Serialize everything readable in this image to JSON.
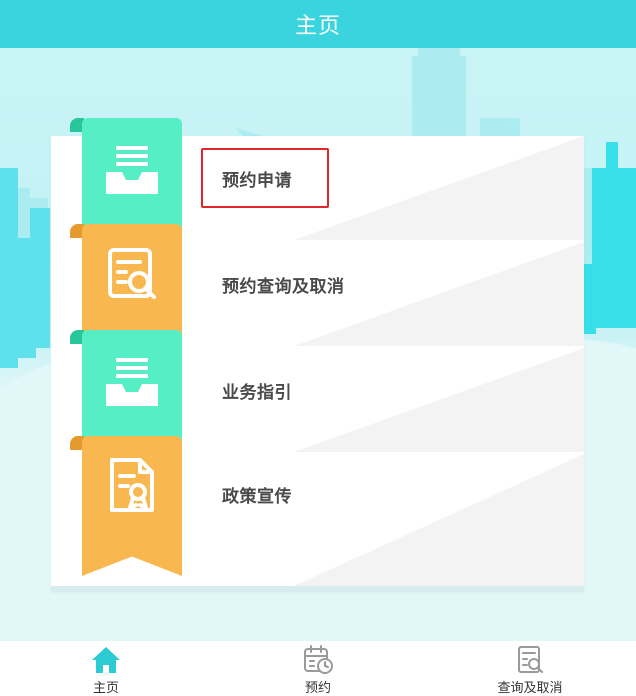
{
  "header": {
    "title": "主页"
  },
  "menu": {
    "items": [
      {
        "label": "预约申请",
        "icon": "inbox-tray-icon",
        "color": "green",
        "highlighted": true
      },
      {
        "label": "预约查询及取消",
        "icon": "document-search-icon",
        "color": "orange",
        "highlighted": false
      },
      {
        "label": "业务指引",
        "icon": "inbox-tray-icon",
        "color": "green",
        "highlighted": false
      },
      {
        "label": "政策宣传",
        "icon": "certificate-icon",
        "color": "orange",
        "highlighted": false
      }
    ]
  },
  "bottom_nav": {
    "items": [
      {
        "label": "主页",
        "icon": "home-icon",
        "active": true
      },
      {
        "label": "预约",
        "icon": "calendar-clock-icon",
        "active": false
      },
      {
        "label": "查询及取消",
        "icon": "document-search-icon",
        "active": false
      }
    ]
  },
  "colors": {
    "header": "#39d4de",
    "accent_green": "#55eec5",
    "accent_orange": "#f8b84f",
    "highlight_border": "#e0262b"
  }
}
